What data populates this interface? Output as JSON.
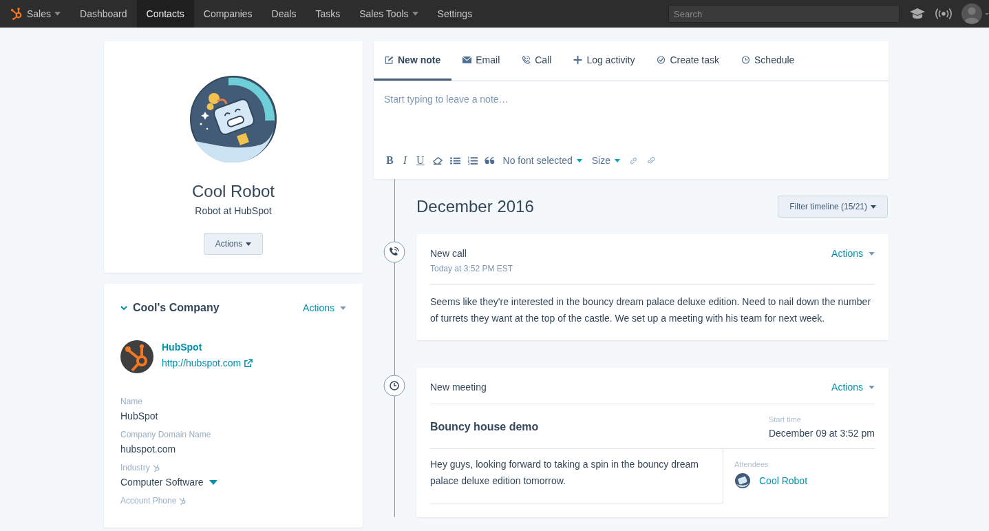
{
  "nav": {
    "items": [
      {
        "label": "Sales",
        "selected": false,
        "dropdown": true,
        "logo": true
      },
      {
        "label": "Dashboard",
        "selected": false,
        "dropdown": false,
        "logo": false
      },
      {
        "label": "Contacts",
        "selected": true,
        "dropdown": false,
        "logo": false
      },
      {
        "label": "Companies",
        "selected": false,
        "dropdown": false,
        "logo": false
      },
      {
        "label": "Deals",
        "selected": false,
        "dropdown": false,
        "logo": false
      },
      {
        "label": "Tasks",
        "selected": false,
        "dropdown": false,
        "logo": false
      },
      {
        "label": "Sales Tools",
        "selected": false,
        "dropdown": true,
        "logo": false
      },
      {
        "label": "Settings",
        "selected": false,
        "dropdown": false,
        "logo": false
      }
    ],
    "search": {
      "placeholder": "Search"
    }
  },
  "contact": {
    "name": "Cool Robot",
    "title": "Robot at HubSpot",
    "actions": "Actions"
  },
  "company": {
    "heading": "Cool's Company",
    "expanded": true,
    "actions": "Actions",
    "name": "HubSpot",
    "url": "http://hubspot.com",
    "fields": [
      {
        "label": "Name",
        "value": "HubSpot",
        "synced": false,
        "dropdown": false
      },
      {
        "label": "Company Domain Name",
        "value": "hubspot.com",
        "synced": false,
        "dropdown": false
      },
      {
        "label": "Industry",
        "value": "Computer Software",
        "synced": true,
        "dropdown": true
      },
      {
        "label": "Account Phone",
        "synced": true,
        "dropdown": false
      }
    ]
  },
  "composer": {
    "tabs": [
      {
        "label": "New note",
        "selected": true
      },
      {
        "label": "Email",
        "selected": false
      },
      {
        "label": "Call",
        "selected": false
      },
      {
        "label": "Log activity",
        "selected": false
      },
      {
        "label": "Create task",
        "selected": false
      },
      {
        "label": "Schedule",
        "selected": false
      }
    ],
    "placeholder": "Start typing to leave a note…",
    "format_buttons": [
      "B",
      "I",
      "U"
    ],
    "font_select": "No font selected",
    "size_select": "Size"
  },
  "timeline": {
    "month": "December 2016",
    "filter": "Filter timeline (15/21)",
    "events": [
      {
        "kind": "call",
        "title": "New call",
        "time": "Today at 3:52 PM EST",
        "actions": "Actions",
        "body": "Seems like they're interested in the bouncy dream palace deluxe edition. Need to nail down the number of turrets they want at the top of the castle. We set up a meeting with his team for next week."
      },
      {
        "kind": "meeting",
        "title": "New meeting",
        "actions": "Actions",
        "meeting_title": "Bouncy house demo",
        "start_label": "Start time",
        "start": "December 09 at 3:52 pm",
        "body": "Hey guys, looking forward to taking a spin in the bouncy dream palace deluxe edition tomorrow.",
        "attendees_label": "Attendees",
        "attendee": "Cool Robot"
      }
    ]
  }
}
